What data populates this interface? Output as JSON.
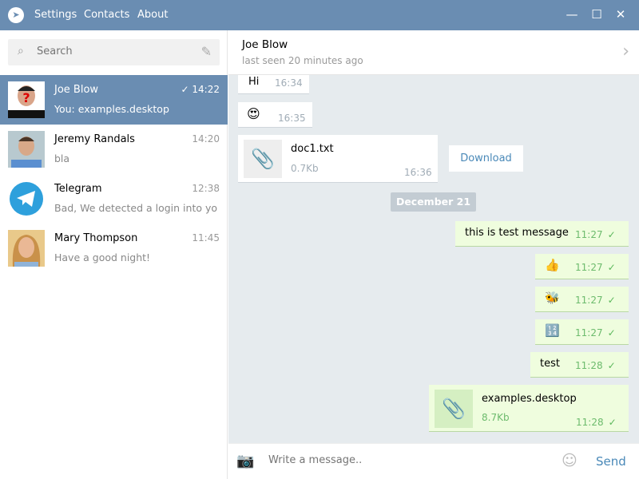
{
  "titlebar": {
    "menu": [
      "Settings",
      "Contacts",
      "About"
    ],
    "minimize": "—",
    "maximize": "☐",
    "close": "✕"
  },
  "search": {
    "placeholder": "Search"
  },
  "dialogs": [
    {
      "name": "Joe Blow",
      "time": "14:22",
      "preview": "You: examples.desktop",
      "read": "✓",
      "active": true
    },
    {
      "name": "Jeremy Randals",
      "time": "14:20",
      "preview": "bla"
    },
    {
      "name": "Telegram",
      "time": "12:38",
      "preview": "Bad, We detected a login into yo..."
    },
    {
      "name": "Mary Thompson",
      "time": "11:45",
      "preview": "Have a good night!"
    }
  ],
  "chat": {
    "name": "Joe Blow",
    "status": "last seen 20 minutes ago"
  },
  "messages": {
    "m1": {
      "text": "Hi",
      "time": "16:34"
    },
    "m2": {
      "text": "😍",
      "time": "16:35"
    },
    "m3": {
      "file": "doc1.txt",
      "size": "0.7Kb",
      "time": "16:36",
      "action": "Download"
    },
    "date": "December 21",
    "m4": {
      "text": "this is test message",
      "time": "11:27"
    },
    "m5": {
      "text": "👍",
      "time": "11:27"
    },
    "m6": {
      "text": "🐝",
      "time": "11:27"
    },
    "m7": {
      "text": "🔢",
      "time": "11:27"
    },
    "m8": {
      "text": "test",
      "time": "11:28"
    },
    "m9": {
      "file": "examples.desktop",
      "size": "8.7Kb",
      "time": "11:28"
    },
    "check": "✓"
  },
  "input": {
    "placeholder": "Write a message..",
    "send": "Send"
  },
  "colors": {
    "accent": "#6a8db2",
    "outgoing": "#effdde",
    "background": "#e6ebee"
  }
}
